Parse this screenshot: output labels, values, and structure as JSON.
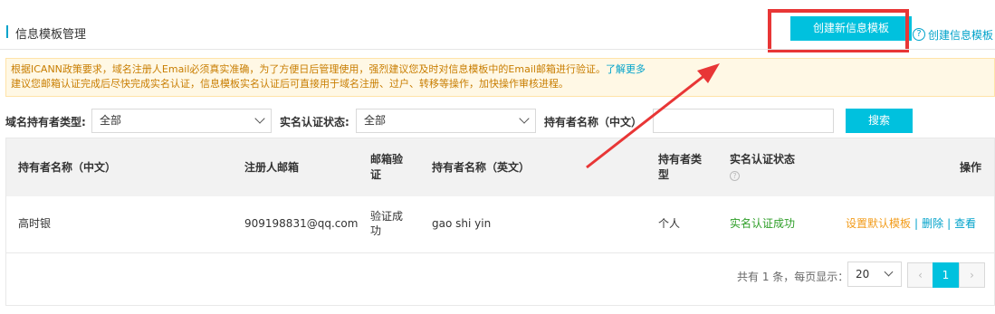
{
  "header": {
    "title": "信息模板管理",
    "create_button": "创建新信息模板",
    "create_link": "创建信息模板"
  },
  "notice": {
    "line1": "根据ICANN政策要求，域名注册人Email必须真实准确，为了方便日后管理使用，强烈建议您及时对信息模板中的Email邮箱进行验证。",
    "learn_more": "了解更多",
    "line2": "建议您邮箱认证完成后尽快完成实名认证，信息模板实名认证后可直接用于域名注册、过户、转移等操作，加快操作审核进程。"
  },
  "filter": {
    "holder_type_label": "域名持有者类型:",
    "holder_type_value": "全部",
    "realname_label": "实名认证状态:",
    "realname_value": "全部",
    "holder_name_label": "持有者名称（中文）",
    "search_button": "搜索"
  },
  "table": {
    "headers": {
      "name_cn": "持有者名称（中文）",
      "email": "注册人邮箱",
      "email_verify_1": "邮箱验",
      "email_verify_2": "证",
      "name_en": "持有者名称（英文）",
      "holder_type_1": "持有者类",
      "holder_type_2": "型",
      "realname_status": "实名认证状态",
      "actions": "操作"
    },
    "rows": [
      {
        "name_cn": "高时银",
        "email": "909198831@qq.com",
        "email_verify_1": "验证成",
        "email_verify_2": "功",
        "name_en": "gao shi yin",
        "holder_type": "个人",
        "realname_status": "实名认证成功",
        "action_default": "设置默认模板",
        "action_delete": "删除",
        "action_view": "查看"
      }
    ]
  },
  "pagination": {
    "summary": "共有 1 条，每页显示：",
    "page_size": "20",
    "prev": "‹",
    "current_page": "1",
    "next": "›"
  },
  "colors": {
    "accent": "#00c1de",
    "link": "#00a2ca",
    "highlight": "#e83636",
    "success": "#2e9e28",
    "warning_text": "#c87d00"
  }
}
